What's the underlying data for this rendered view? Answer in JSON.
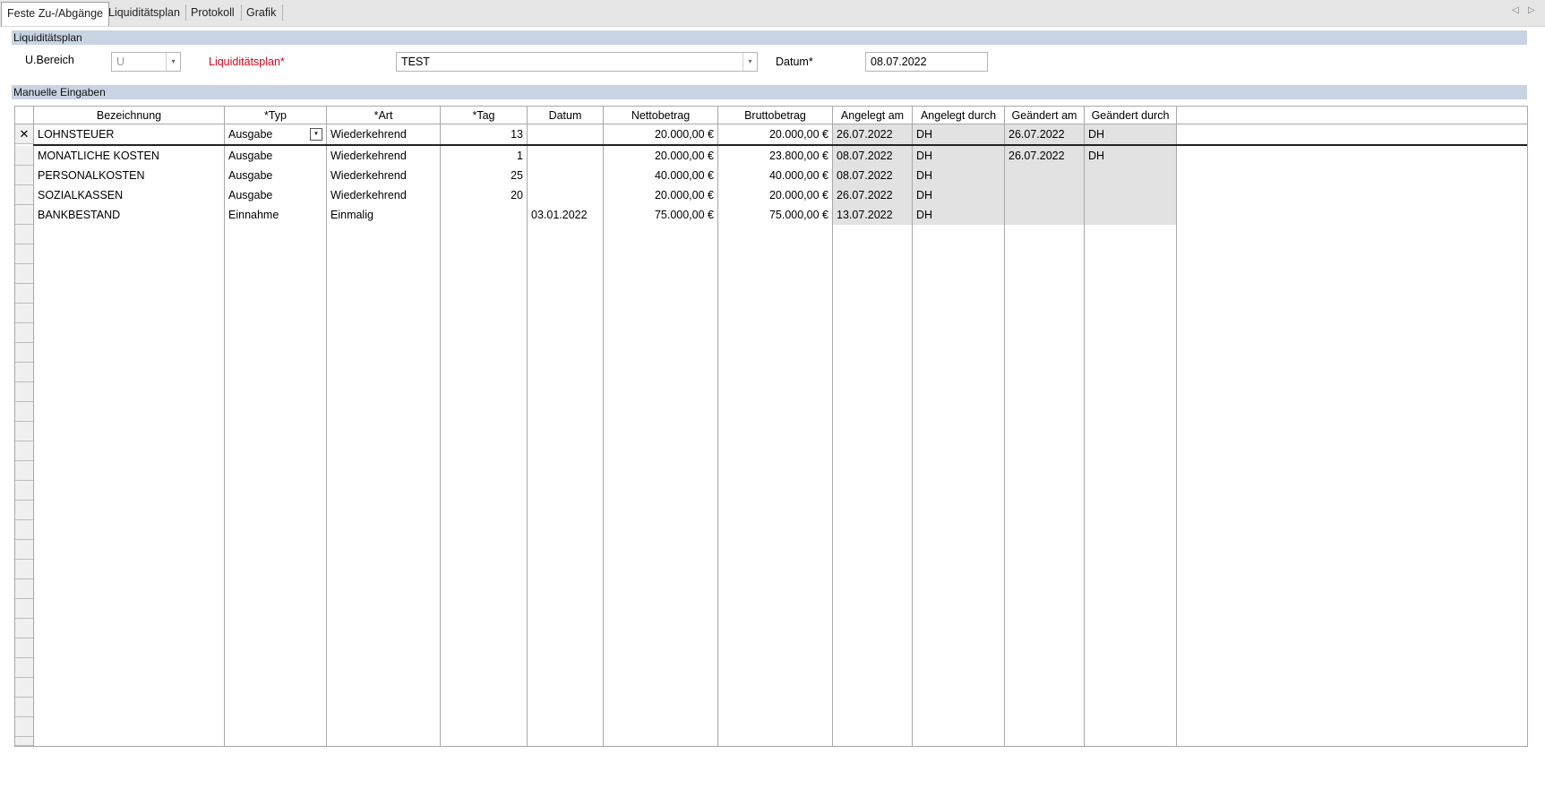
{
  "tabs": [
    {
      "label": "Feste Zu-/Abgänge",
      "active": true
    },
    {
      "label": "Liquiditätsplan",
      "active": false
    },
    {
      "label": "Protokoll",
      "active": false
    },
    {
      "label": "Grafik",
      "active": false
    }
  ],
  "nav": {
    "prev": "◁",
    "next": "▷"
  },
  "section_plan": "Liquiditätsplan",
  "form": {
    "ubereich_label": "U.Bereich",
    "ubereich_value": "U",
    "plan_label": "Liquiditätsplan*",
    "plan_value": "TEST",
    "datum_label": "Datum*",
    "datum_value": "08.07.2022",
    "dropdown_glyph": "▾"
  },
  "section_manual": "Manuelle Eingaben",
  "grid": {
    "columns": [
      "Bezeichnung",
      "*Typ",
      "*Art",
      "*Tag",
      "Datum",
      "Nettobetrag",
      "Bruttobetrag",
      "Angelegt am",
      "Angelegt durch",
      "Geändert am",
      "Geändert durch"
    ],
    "current_marker": "✕",
    "rows": [
      {
        "bezeichnung": "LOHNSTEUER",
        "typ": "Ausgabe",
        "art": "Wiederkehrend",
        "tag": "13",
        "datum": "",
        "netto": "20.000,00 €",
        "brutto": "20.000,00 €",
        "angelegt_am": "26.07.2022",
        "angelegt_durch": "DH",
        "geaendert_am": "26.07.2022",
        "geaendert_durch": "DH"
      },
      {
        "bezeichnung": "MONATLICHE KOSTEN",
        "typ": "Ausgabe",
        "art": "Wiederkehrend",
        "tag": "1",
        "datum": "",
        "netto": "20.000,00 €",
        "brutto": "23.800,00 €",
        "angelegt_am": "08.07.2022",
        "angelegt_durch": "DH",
        "geaendert_am": "26.07.2022",
        "geaendert_durch": "DH"
      },
      {
        "bezeichnung": "PERSONALKOSTEN",
        "typ": "Ausgabe",
        "art": "Wiederkehrend",
        "tag": "25",
        "datum": "",
        "netto": "40.000,00 €",
        "brutto": "40.000,00 €",
        "angelegt_am": "08.07.2022",
        "angelegt_durch": "DH",
        "geaendert_am": "",
        "geaendert_durch": ""
      },
      {
        "bezeichnung": "SOZIALKASSEN",
        "typ": "Ausgabe",
        "art": "Wiederkehrend",
        "tag": "20",
        "datum": "",
        "netto": "20.000,00 €",
        "brutto": "20.000,00 €",
        "angelegt_am": "26.07.2022",
        "angelegt_durch": "DH",
        "geaendert_am": "",
        "geaendert_durch": ""
      },
      {
        "bezeichnung": "BANKBESTAND",
        "typ": "Einnahme",
        "art": "Einmalig",
        "tag": "",
        "datum": "03.01.2022",
        "netto": "75.000,00 €",
        "brutto": "75.000,00 €",
        "angelegt_am": "13.07.2022",
        "angelegt_durch": "DH",
        "geaendert_am": "",
        "geaendert_durch": ""
      }
    ]
  }
}
